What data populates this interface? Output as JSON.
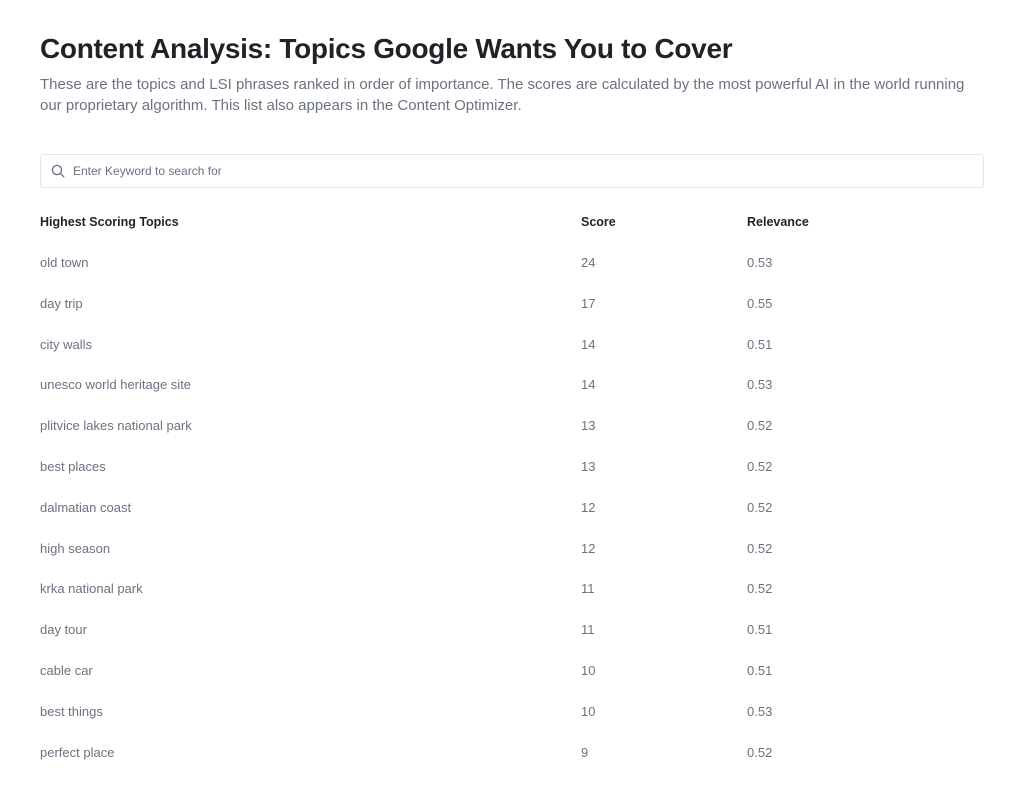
{
  "header": {
    "title": "Content Analysis: Topics Google Wants You to Cover",
    "subtitle": "These are the topics and LSI phrases ranked in order of importance. The scores are calculated by the most powerful AI in the world running our proprietary algorithm. This list also appears in the Content Optimizer."
  },
  "search": {
    "icon": "search-icon",
    "placeholder": "Enter Keyword to search for",
    "value": ""
  },
  "table": {
    "columns": [
      "Highest Scoring Topics",
      "Score",
      "Relevance"
    ],
    "rows": [
      {
        "topic": "old town",
        "score": "24",
        "relevance": "0.53"
      },
      {
        "topic": "day trip",
        "score": "17",
        "relevance": "0.55"
      },
      {
        "topic": "city walls",
        "score": "14",
        "relevance": "0.51"
      },
      {
        "topic": "unesco world heritage site",
        "score": "14",
        "relevance": "0.53"
      },
      {
        "topic": "plitvice lakes national park",
        "score": "13",
        "relevance": "0.52"
      },
      {
        "topic": "best places",
        "score": "13",
        "relevance": "0.52"
      },
      {
        "topic": "dalmatian coast",
        "score": "12",
        "relevance": "0.52"
      },
      {
        "topic": "high season",
        "score": "12",
        "relevance": "0.52"
      },
      {
        "topic": "krka national park",
        "score": "11",
        "relevance": "0.52"
      },
      {
        "topic": "day tour",
        "score": "11",
        "relevance": "0.51"
      },
      {
        "topic": "cable car",
        "score": "10",
        "relevance": "0.51"
      },
      {
        "topic": "best things",
        "score": "10",
        "relevance": "0.53"
      },
      {
        "topic": "perfect place",
        "score": "9",
        "relevance": "0.52"
      }
    ]
  },
  "colors": {
    "title": "#1f2328",
    "muted_text": "#6b7280",
    "border": "#e3e5e8",
    "background": "#ffffff"
  }
}
